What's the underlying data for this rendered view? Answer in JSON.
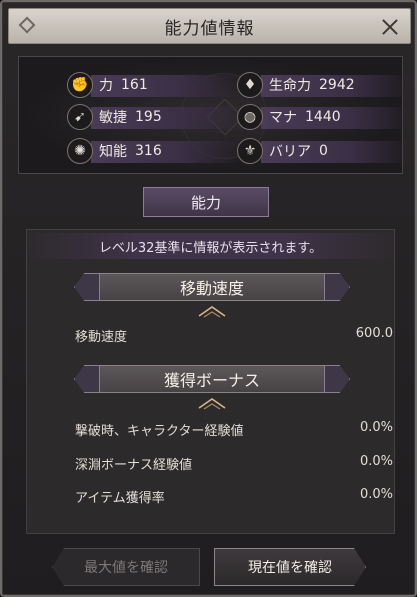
{
  "window": {
    "title": "能力値情報"
  },
  "stats": [
    {
      "icon": "strength-icon",
      "glyph": "✊",
      "label": "力",
      "value": "161"
    },
    {
      "icon": "agility-icon",
      "glyph": "➹",
      "label": "敏捷",
      "value": "195"
    },
    {
      "icon": "intellect-icon",
      "glyph": "✺",
      "label": "知能",
      "value": "316"
    },
    {
      "icon": "vitality-icon",
      "glyph": "♦",
      "label": "生命力",
      "value": "2942"
    },
    {
      "icon": "mana-icon",
      "glyph": "◍",
      "label": "マナ",
      "value": "1440"
    },
    {
      "icon": "barrier-icon",
      "glyph": "⚜",
      "label": "バリア",
      "value": "0"
    }
  ],
  "tab": {
    "label": "能力"
  },
  "notice": "レベル32基準に情報が表示されます。",
  "sections": {
    "movement": {
      "title": "移動速度",
      "rows": [
        {
          "label": "移動速度",
          "value": "600.0"
        }
      ]
    },
    "acquisition": {
      "title": "獲得ボーナス",
      "rows": [
        {
          "label": "撃破時、キャラクター経験値",
          "value": "0.0%"
        },
        {
          "label": "深淵ボーナス経験値",
          "value": "0.0%"
        },
        {
          "label": "アイテム獲得率",
          "value": "0.0%"
        }
      ]
    }
  },
  "footer": {
    "max_label": "最大値を確認",
    "current_label": "現在値を確認"
  }
}
